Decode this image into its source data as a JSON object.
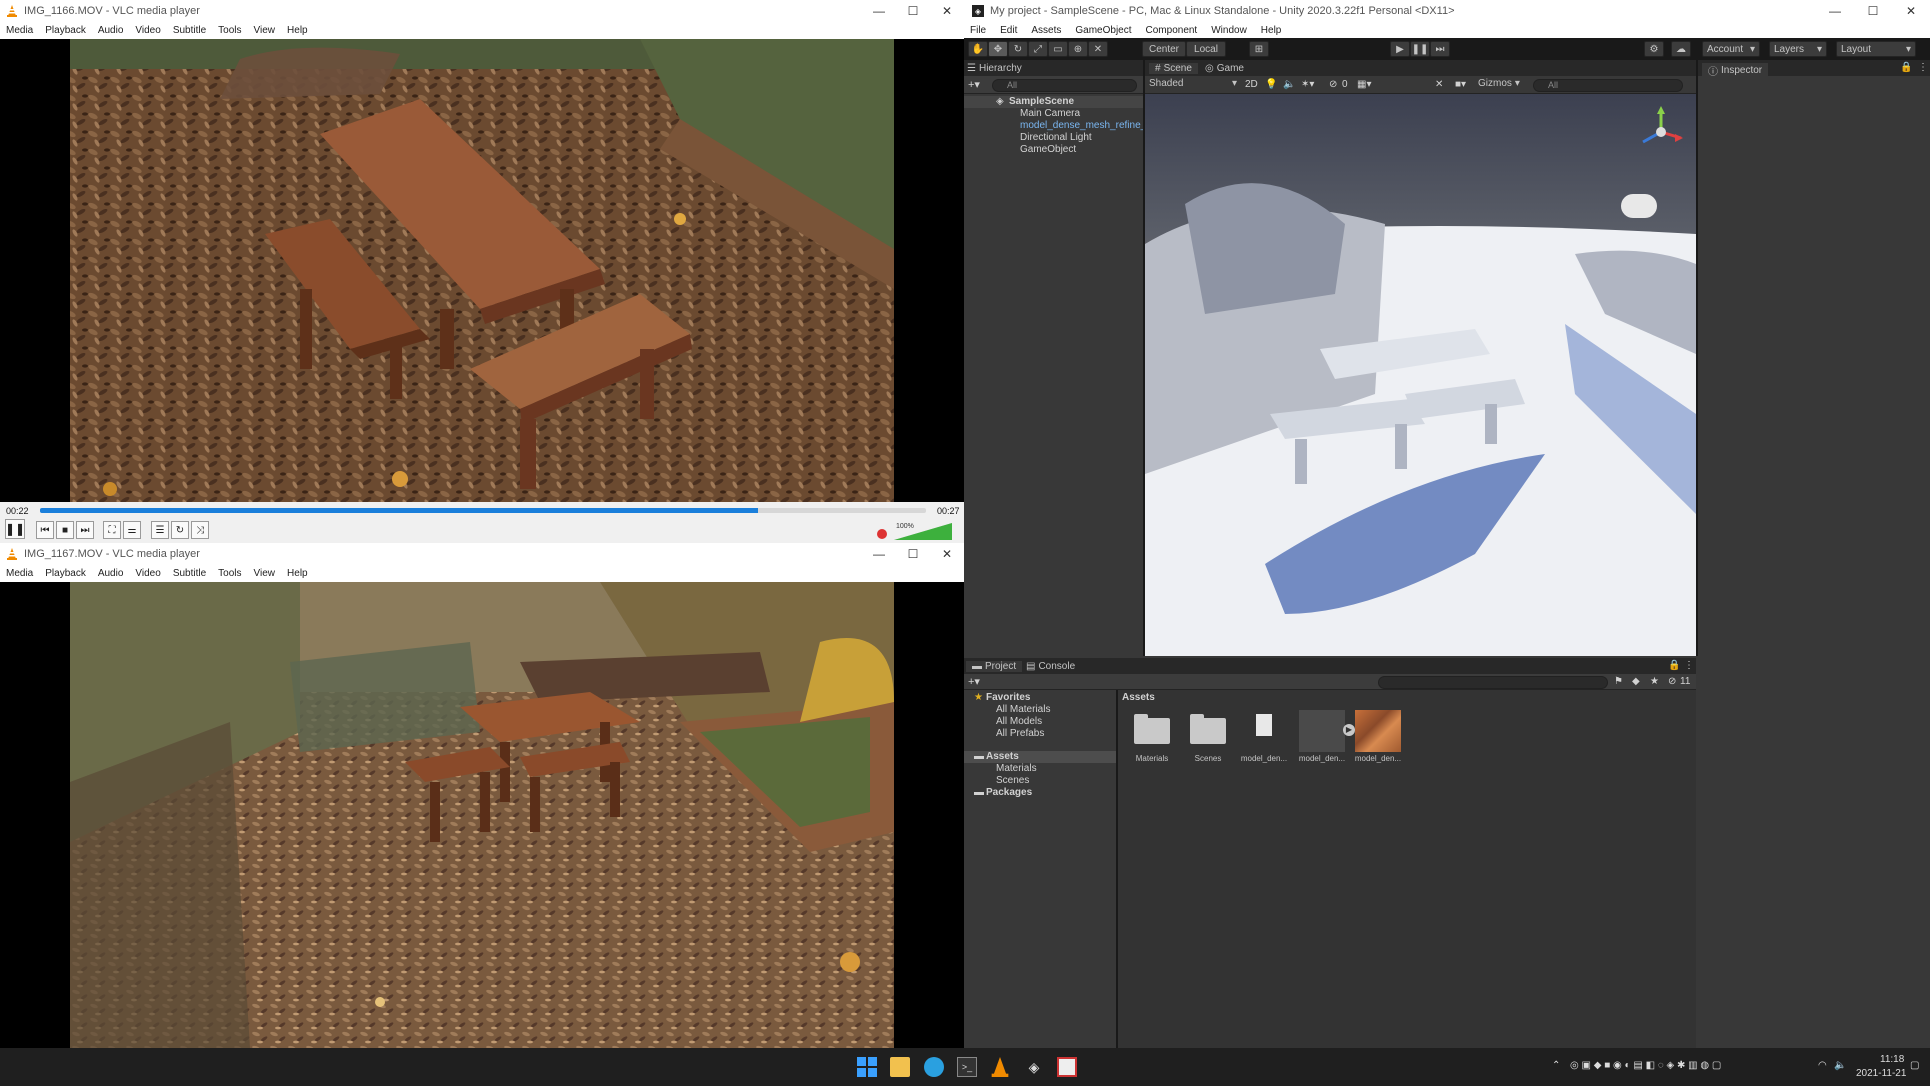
{
  "vlc_top": {
    "title": "IMG_1166.MOV - VLC media player",
    "menu": [
      "Media",
      "Playback",
      "Audio",
      "Video",
      "Subtitle",
      "Tools",
      "View",
      "Help"
    ],
    "elapsed": "00:22",
    "total": "00:27",
    "progress": 0.81,
    "volume_label": "100%",
    "volume": 1.0
  },
  "vlc_bottom": {
    "title": "IMG_1167.MOV - VLC media player",
    "menu": [
      "Media",
      "Playback",
      "Audio",
      "Video",
      "Subtitle",
      "Tools",
      "View",
      "Help"
    ]
  },
  "window_controls": {
    "minimize": "—",
    "maximize": "☐",
    "close": "✕"
  },
  "unity": {
    "title": "My project - SampleScene - PC, Mac & Linux Standalone - Unity 2020.3.22f1 Personal <DX11>",
    "menu": [
      "File",
      "Edit",
      "Assets",
      "GameObject",
      "Component",
      "Window",
      "Help"
    ],
    "toolbar": {
      "pivot": "Center",
      "space": "Local",
      "account": "Account",
      "layers": "Layers",
      "layout": "Layout"
    },
    "hierarchy": {
      "tab": "Hierarchy",
      "search_placeholder": "All",
      "scene": "SampleScene",
      "items": [
        "Main Camera",
        "model_dense_mesh_refine_te",
        "Directional Light",
        "GameObject"
      ]
    },
    "scene_view": {
      "tab_scene": "Scene",
      "tab_game": "Game",
      "shading": "Shaded",
      "mode_2d": "2D",
      "gizmos": "Gizmos",
      "search_placeholder": "All",
      "hidden_count": "0"
    },
    "inspector": {
      "tab": "Inspector"
    },
    "project": {
      "tab_project": "Project",
      "tab_console": "Console",
      "favorites_label": "Favorites",
      "favorites": [
        "All Materials",
        "All Models",
        "All Prefabs"
      ],
      "assets_label": "Assets",
      "asset_folders": [
        "Materials",
        "Scenes"
      ],
      "packages_label": "Packages",
      "breadcrumb": "Assets",
      "item_count": "11",
      "grid": [
        "Materials",
        "Scenes",
        "model_den...",
        "model_den...",
        "model_den..."
      ]
    }
  },
  "taskbar": {
    "clock_time": "11:18",
    "clock_date": "2021-11-21"
  }
}
